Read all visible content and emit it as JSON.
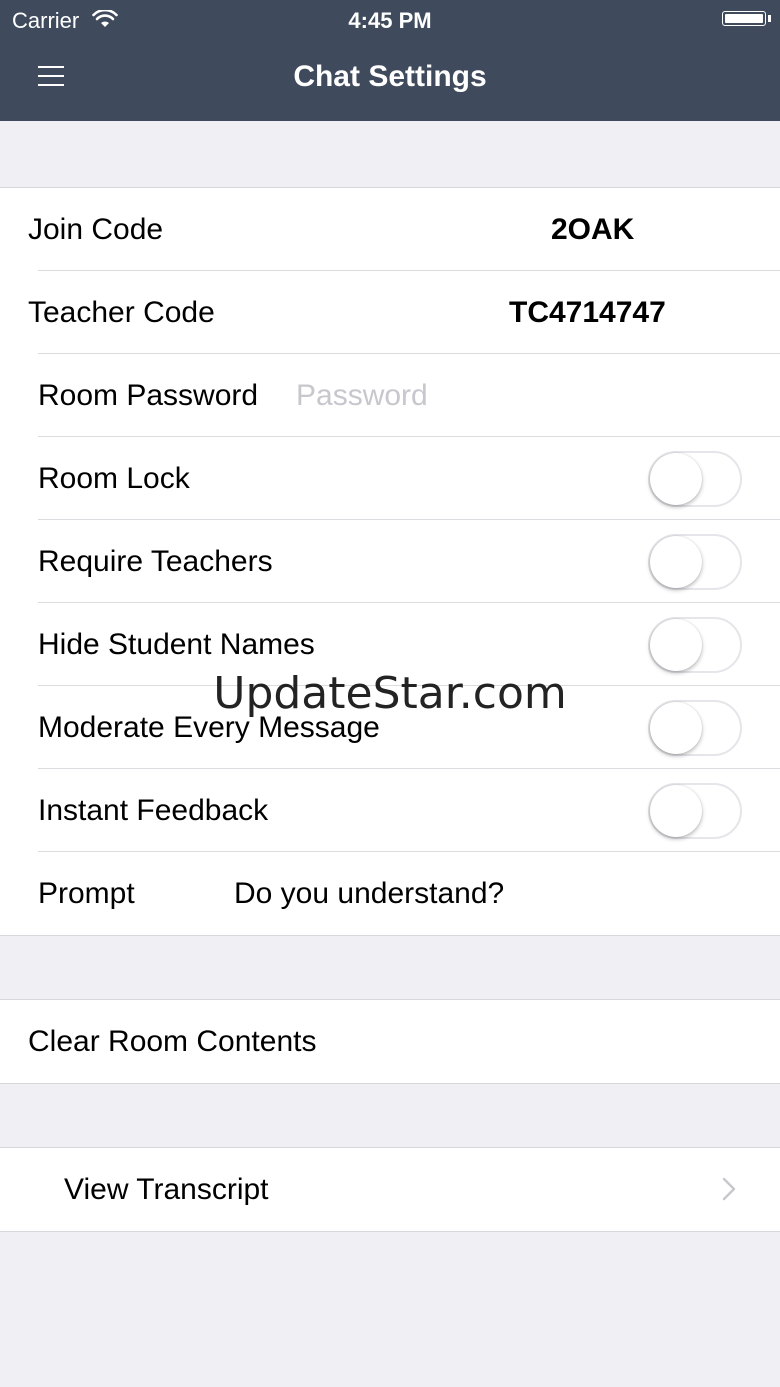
{
  "status_bar": {
    "carrier": "Carrier",
    "time": "4:45 PM"
  },
  "header": {
    "title": "Chat Settings",
    "menu_icon": "hamburger-menu-icon"
  },
  "settings": {
    "join_code": {
      "label": "Join Code",
      "value": "2OAK"
    },
    "teacher_code": {
      "label": "Teacher Code",
      "value": "TC4714747"
    },
    "room_password": {
      "label": "Room Password",
      "placeholder": "Password",
      "value": ""
    },
    "room_lock": {
      "label": "Room Lock",
      "on": false
    },
    "require_teachers": {
      "label": "Require Teachers",
      "on": false
    },
    "hide_student_names": {
      "label": "Hide Student Names",
      "on": false
    },
    "moderate_every_message": {
      "label": "Moderate Every Message",
      "on": false
    },
    "instant_feedback": {
      "label": "Instant Feedback",
      "on": false
    },
    "prompt": {
      "label": "Prompt",
      "value": "Do you understand?"
    }
  },
  "actions": {
    "clear_room": {
      "label": "Clear Room Contents"
    },
    "view_transcript": {
      "label": "View Transcript",
      "icon": "chevron-right-icon"
    }
  },
  "watermark": "UpdateStar.com",
  "colors": {
    "nav_bar": "#3f4b5c",
    "background": "#efeff4",
    "toggle_border": "#e5e5ea",
    "placeholder": "#c7c7cd"
  }
}
